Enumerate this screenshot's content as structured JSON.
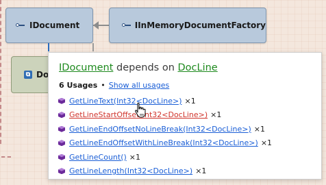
{
  "diagram": {
    "nodes": {
      "idocument": {
        "label": "IDocument",
        "icon": "interface-icon"
      },
      "factory": {
        "label": "IInMemoryDocumentFactory",
        "icon": "interface-icon"
      },
      "docline": {
        "label": "Do",
        "icon": "class-icon"
      }
    }
  },
  "popup": {
    "title_source": "IDocument",
    "title_mid": "depends on",
    "title_target": "DocLine",
    "usage_count": "6 Usages",
    "bullet": "•",
    "show_all": "Show all usages",
    "usages": [
      {
        "name": "GetLineText(Int32<DocLine>)",
        "count": "×1",
        "active": false
      },
      {
        "name": "GetLineStartOffset(Int32<DocLine>)",
        "count": "×1",
        "active": true
      },
      {
        "name": "GetLineEndOffsetNoLineBreak(Int32<DocLine>)",
        "count": "×1",
        "active": false
      },
      {
        "name": "GetLineEndOffsetWithLineBreak(Int32<DocLine>)",
        "count": "×1",
        "active": false
      },
      {
        "name": "GetLineCount()",
        "count": "×1",
        "active": false
      },
      {
        "name": "GetLineLength(Int32<DocLine>)",
        "count": "×1",
        "active": false
      }
    ]
  },
  "colors": {
    "node_interface": "#b8c9dc",
    "node_class": "#ccd3bb",
    "link": "#1a5ed6",
    "link_active": "#d0342c",
    "type_link": "#1e8a1e",
    "method_icon": "#6b2a9a"
  }
}
